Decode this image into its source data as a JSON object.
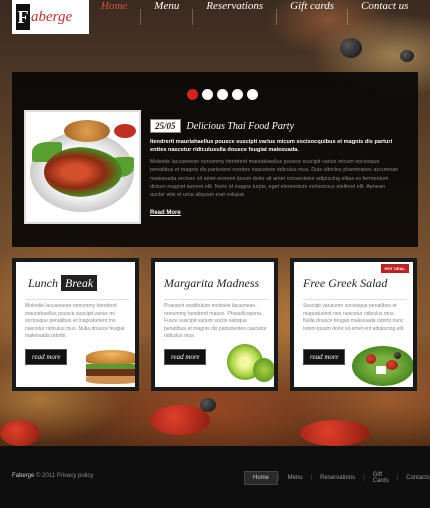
{
  "brand": {
    "logo_letter": "F",
    "logo_rest": "aberge"
  },
  "nav": {
    "items": [
      "Home",
      "Menu",
      "Reservations",
      "Gift cards",
      "Contact us"
    ],
    "active_index": 0
  },
  "slider": {
    "slides_count": 5,
    "active_slide": 1,
    "date": "25/05",
    "title": "Delicious Thai Food Party",
    "lead": "Itendrerit mauriahaellus pousce suscipit varius micum socisocquibus et magnis dis parturi enttes nascetur ridiculusulla dousce feugiat malesuada.",
    "body": "Molestie lacusenean nonummy hendrerit mauriahaellus pousce suscipit varius micum sociosque penatibus et magnis dis parturient montes nasceture ridiculus mus. Duis ultricies pharetranec accumsan malesuada orcinec sit amet eroremi ipsum dolor sit amet consectetur adipiscing elitas ex fermentum dictum magnet laoreet elit. Nunc id magna turpis, eget elementum vehicerous eleifend elit. Aenean auctor wisi et urna aliquam erat volupat.",
    "read_more": "Read More",
    "image_alt": "thai-food-plate"
  },
  "boxes": [
    {
      "title_part1": "Lunch",
      "title_part2": "Break",
      "text": "Molestie lacusenean nonummy hendrerit mauriahaellus pousce suscipit varius mi sociosque penatibus et mapraturient mo nascetur ridiculus mus. Nulla dousce feugiat malesuada odorbi.",
      "button": "read more",
      "badge": ""
    },
    {
      "title_part1": "Margarita Madness",
      "title_part2": "",
      "text": "Praesent vestibulum molestie lacusnean nonummy hendrerit mauris. Phasellusporta. Fusce suscipit varium sociis natoque penatibus et magnis dis parturientes nascetur ridiculus mus.",
      "button": "read more",
      "badge": ""
    },
    {
      "title_part1": "Free Greek Salad",
      "title_part2": "",
      "text": "Suscipit varuiumn sociosque penatibus et mapraturient neo nascetur ridiculus mus. Nulla dousce feugiat malesuada odorbi nunc lorem ipsum dolor sit amet ent adipiscing elit.",
      "button": "read more",
      "badge": "HOT DEAL"
    }
  ],
  "footer": {
    "brand": "Faberge",
    "copyright": "© 2011",
    "privacy": "Privacy policy",
    "links": [
      "Home",
      "Menu",
      "Reservations",
      "Gift Cards",
      "Contacts"
    ],
    "active_index": 0
  },
  "colors": {
    "accent": "#d42020",
    "nav_active": "#e0503a",
    "dark": "#0e0e0e"
  }
}
